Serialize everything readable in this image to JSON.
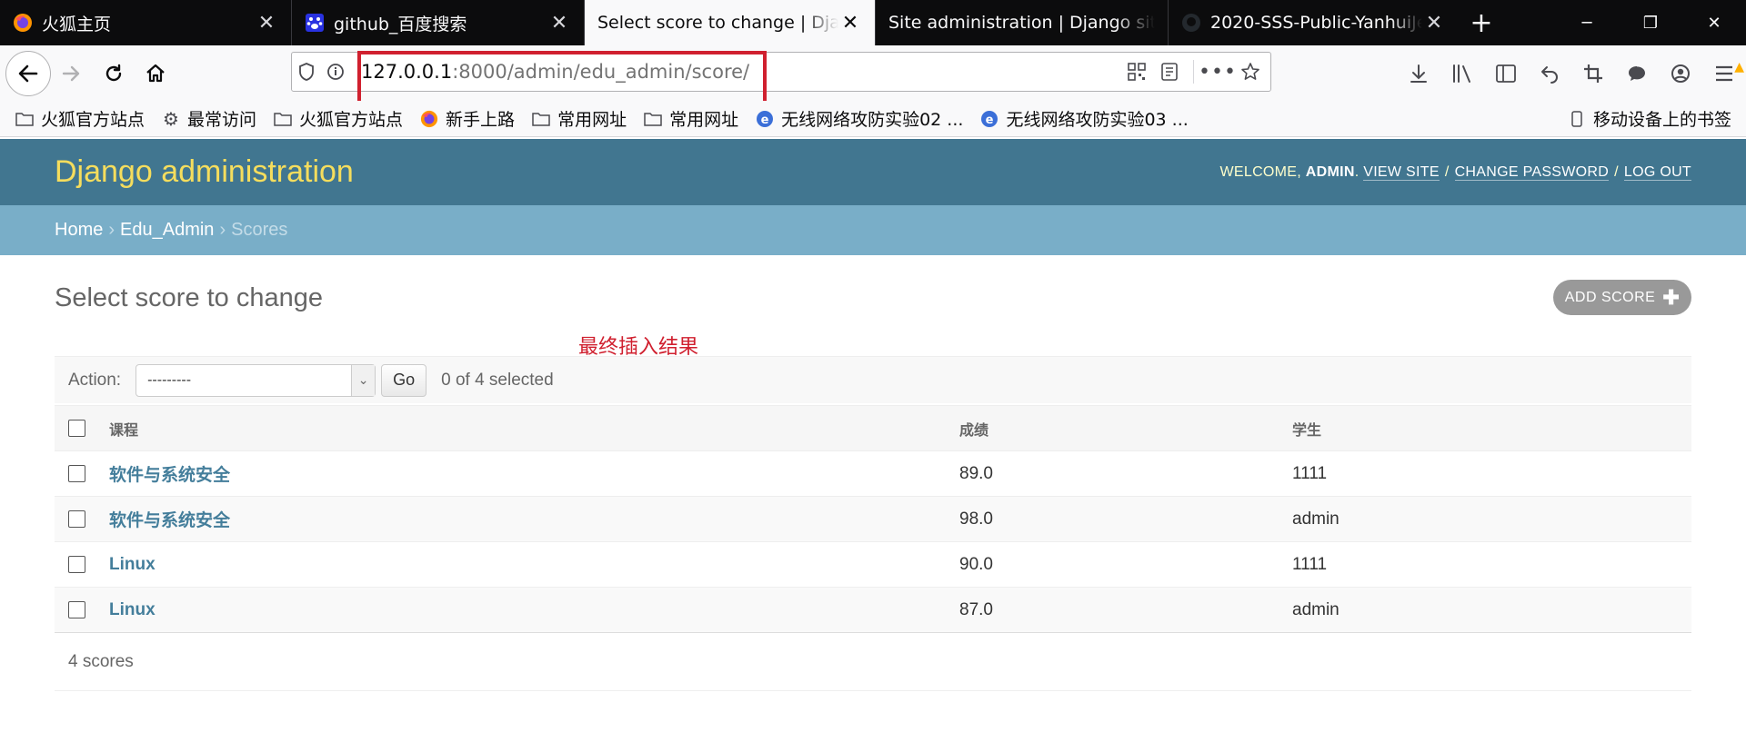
{
  "browser": {
    "tabs": [
      {
        "title": "火狐主页",
        "active": false,
        "favicon": "firefox-icon"
      },
      {
        "title": "github_百度搜索",
        "active": false,
        "favicon": "baidu-icon"
      },
      {
        "title": "Select score to change | Django site admin",
        "active": true,
        "favicon": "none"
      },
      {
        "title": "Site administration | Django site admin",
        "active": false,
        "favicon": "none"
      },
      {
        "title": "2020-SSS-Public-YanhuiJessica",
        "active": false,
        "favicon": "github-icon"
      }
    ],
    "url_host": "127.0.0.1",
    "url_rest": ":8000/admin/edu_admin/score/",
    "bookmarks": [
      {
        "label": "火狐官方站点",
        "icon": "folder-icon"
      },
      {
        "label": "最常访问",
        "icon": "gear-icon"
      },
      {
        "label": "火狐官方站点",
        "icon": "folder-icon"
      },
      {
        "label": "新手上路",
        "icon": "firefox-icon"
      },
      {
        "label": "常用网址",
        "icon": "folder-icon"
      },
      {
        "label": "常用网址",
        "icon": "folder-icon"
      },
      {
        "label": "无线网络攻防实验02 ...",
        "icon": "ie-icon"
      },
      {
        "label": "无线网络攻防实验03 ...",
        "icon": "ie-icon"
      }
    ],
    "mobile_bookmarks": "移动设备上的书签"
  },
  "admin": {
    "brand": "Django administration",
    "welcome": "WELCOME,",
    "user": "ADMIN",
    "view_site": "VIEW SITE",
    "change_password": "CHANGE PASSWORD",
    "log_out": "LOG OUT",
    "breadcrumbs": {
      "home": "Home",
      "app": "Edu_Admin",
      "current": "Scores"
    },
    "title": "Select score to change",
    "add_button": "ADD SCORE",
    "annotation": "最终插入结果",
    "actions": {
      "label": "Action:",
      "selected": "---------",
      "go": "Go",
      "count": "0 of 4 selected"
    },
    "columns": [
      "课程",
      "成绩",
      "学生"
    ],
    "rows": [
      {
        "course": "软件与系统安全",
        "score": "89.0",
        "student": "1111"
      },
      {
        "course": "软件与系统安全",
        "score": "98.0",
        "student": "admin"
      },
      {
        "course": "Linux",
        "score": "90.0",
        "student": "1111"
      },
      {
        "course": "Linux",
        "score": "87.0",
        "student": "admin"
      }
    ],
    "footer": "4 scores"
  },
  "colors": {
    "header": "#417690",
    "breadcrumbs": "#79aec8",
    "brand": "#f5dd5d",
    "link": "#447e9b",
    "annotation": "#d0202f"
  }
}
